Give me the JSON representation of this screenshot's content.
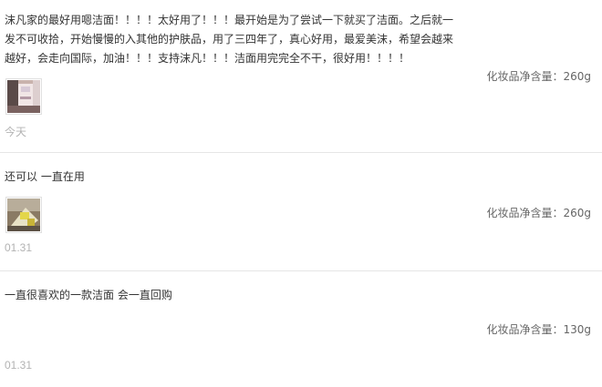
{
  "reviews": [
    {
      "text": "沫凡家的最好用嗯洁面！！！！太好用了！！！最开始是为了尝试一下就买了洁面。之后就一发不可收拾，开始慢慢的入其他的护肤品，用了三四年了，真心好用，最爱美沫，希望会越来越好，会走向国际，加油！！！支持沫凡！！！洁面用完完全不干，很好用！！！！",
      "spec": "化妆品净含量：260g",
      "has_image": true,
      "image_icon": "product-photo-icon",
      "date": "今天"
    },
    {
      "text": "还可以 一直在用",
      "spec": "化妆品净含量：260g",
      "has_image": true,
      "image_icon": "product-photo-icon",
      "date": "01.31"
    },
    {
      "text": "一直很喜欢的一款洁面 会一直回购",
      "spec": "化妆品净含量：130g",
      "has_image": false,
      "date": "01.31"
    }
  ]
}
